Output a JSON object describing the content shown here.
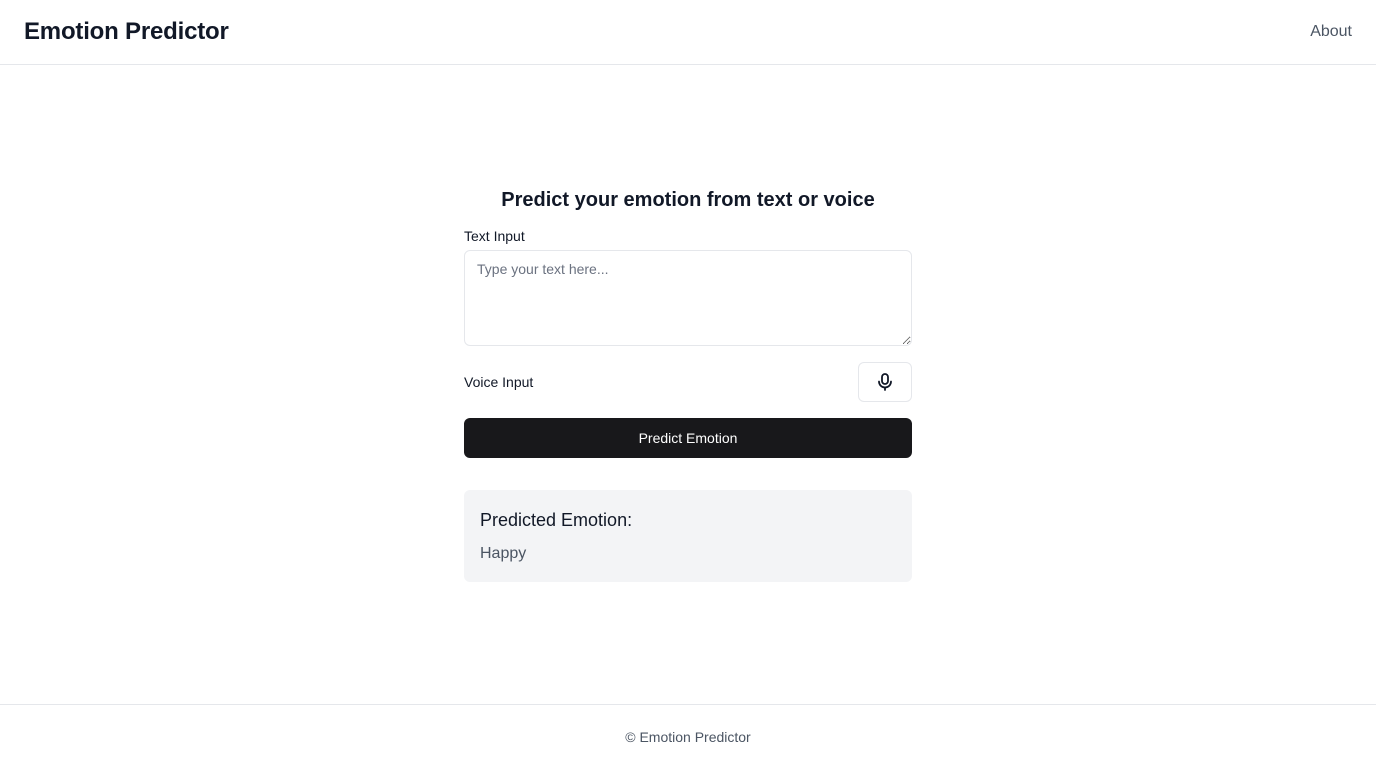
{
  "header": {
    "brand": "Emotion Predictor",
    "nav": {
      "about_label": "About"
    }
  },
  "main": {
    "heading": "Predict your emotion from text or voice",
    "text_input": {
      "label": "Text Input",
      "value": "",
      "placeholder": "Type your text here..."
    },
    "voice_input": {
      "label": "Voice Input",
      "icon": "microphone-icon"
    },
    "predict_button_label": "Predict Emotion",
    "result": {
      "title": "Predicted Emotion:",
      "value": "Happy"
    }
  },
  "footer": {
    "text": "© Emotion Predictor"
  },
  "colors": {
    "primary_button": "#18181b",
    "result_background": "#f3f4f6",
    "border": "#e5e7eb"
  }
}
